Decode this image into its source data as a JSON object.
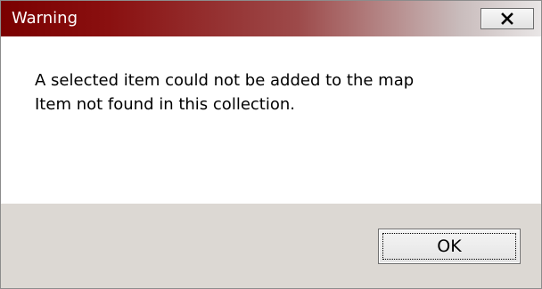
{
  "window": {
    "title": "Warning",
    "close_icon": "close-icon"
  },
  "message": {
    "lines": [
      "A selected item could not be added to the map",
      "Item not found in this collection."
    ]
  },
  "buttons": {
    "ok_label": "OK"
  },
  "colors": {
    "titlebar_start": "#7a0000",
    "titlebar_end": "#e9e6e6",
    "footer_bg": "#dcd8d3"
  }
}
